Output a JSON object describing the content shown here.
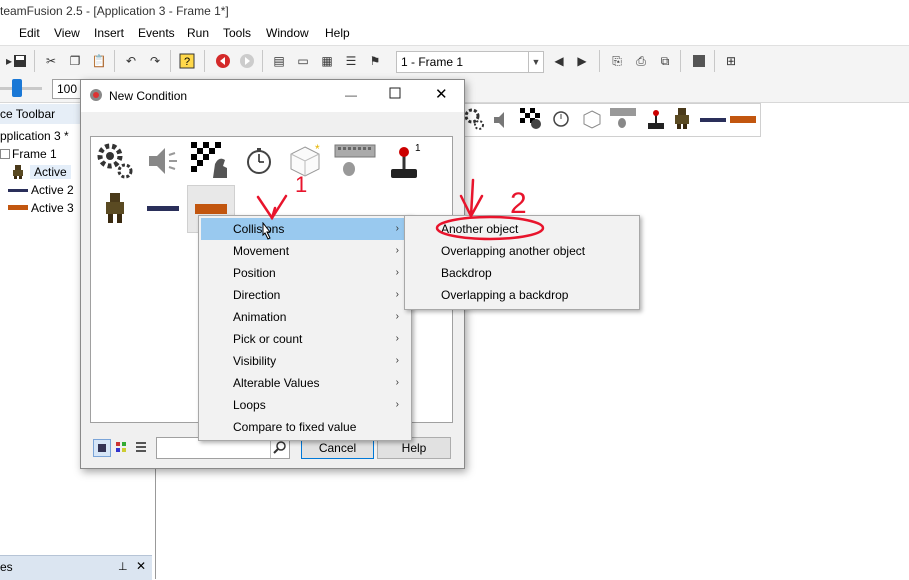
{
  "app": {
    "title": "teamFusion 2.5 - [Application 3 - Frame 1*]"
  },
  "menu": [
    "Edit",
    "View",
    "Insert",
    "Events",
    "Run",
    "Tools",
    "Window",
    "Help"
  ],
  "toolbar": {
    "frame_select": "1 - Frame 1",
    "zoom_value": "100"
  },
  "left_panel": {
    "header": "ce Toolbar",
    "tree": [
      "pplication 3 *",
      "Frame 1",
      "Active",
      "Active 2",
      "Active 3"
    ],
    "bottom_label": "es"
  },
  "dialog": {
    "title": "New Condition",
    "cancel_label": "Cancel",
    "help_label": "Help",
    "search_value": ""
  },
  "context_menu": {
    "items": [
      "Collisions",
      "Movement",
      "Position",
      "Direction",
      "Animation",
      "Pick or count",
      "Visibility",
      "Alterable Values",
      "Loops",
      "Compare to fixed value"
    ]
  },
  "submenu": {
    "items": [
      "Another object",
      "Overlapping another object",
      "Backdrop",
      "Overlapping a backdrop"
    ]
  },
  "annotations": {
    "mark1": "1",
    "mark2": "2"
  },
  "colors": {
    "highlight": "#99c9ef",
    "annotation": "#e8142c",
    "active2_bar": "#2a2f5a",
    "active3_bar": "#c2560f"
  }
}
